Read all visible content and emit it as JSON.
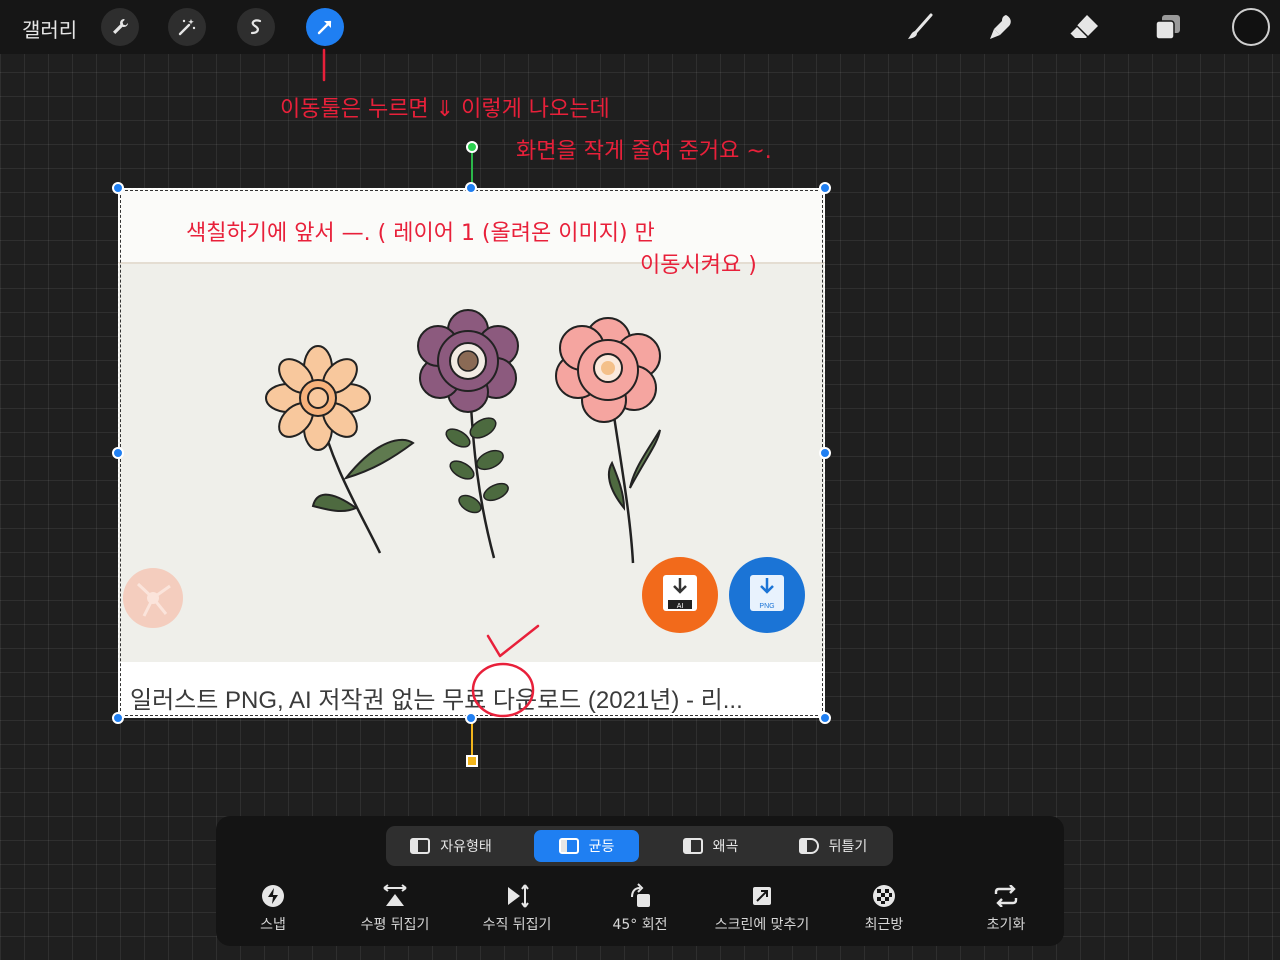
{
  "topbar": {
    "gallery_label": "갤러리",
    "tools": [
      {
        "name": "wrench-icon"
      },
      {
        "name": "magic-wand-icon"
      },
      {
        "name": "selection-icon"
      },
      {
        "name": "transform-arrow-icon",
        "active": true
      }
    ],
    "right_tools": [
      "brush-icon",
      "smudge-icon",
      "eraser-icon",
      "layers-icon"
    ],
    "color_well": "#111111"
  },
  "canvas": {
    "layer_caption": "일러스트 PNG, AI 저작권 없는 무료 다운로드 (2021년) - 리...",
    "download_badges": [
      "AI",
      "PNG"
    ]
  },
  "annotations": {
    "line1": "이동툴은 누르면 ⇓ 이렇게 나오는데",
    "line2": "화면을 작게 줄여 준거요 ~.",
    "line3": "색칠하기에 앞서 —. ( 레이어 1 (올려온 이미지) 만",
    "line4": "이동시켜요 )"
  },
  "transform_panel": {
    "modes": [
      {
        "label": "자유형태",
        "active": false
      },
      {
        "label": "균등",
        "active": true
      },
      {
        "label": "왜곡",
        "active": false
      },
      {
        "label": "뒤틀기",
        "active": false
      }
    ],
    "actions": [
      {
        "label": "스냅",
        "icon": "snap-icon"
      },
      {
        "label": "수평 뒤집기",
        "icon": "flip-horizontal-icon"
      },
      {
        "label": "수직 뒤집기",
        "icon": "flip-vertical-icon"
      },
      {
        "label": "45° 회전",
        "icon": "rotate-icon"
      },
      {
        "label": "스크린에 맞추기",
        "icon": "fit-screen-icon"
      },
      {
        "label": "최근방",
        "icon": "nearest-neighbor-icon"
      },
      {
        "label": "초기화",
        "icon": "reset-icon"
      }
    ]
  },
  "colors": {
    "accent": "#1f7ff2",
    "annotation": "#e8203a",
    "rotation_handle": "#2bd14f",
    "anchor_handle": "#f2b51c"
  }
}
